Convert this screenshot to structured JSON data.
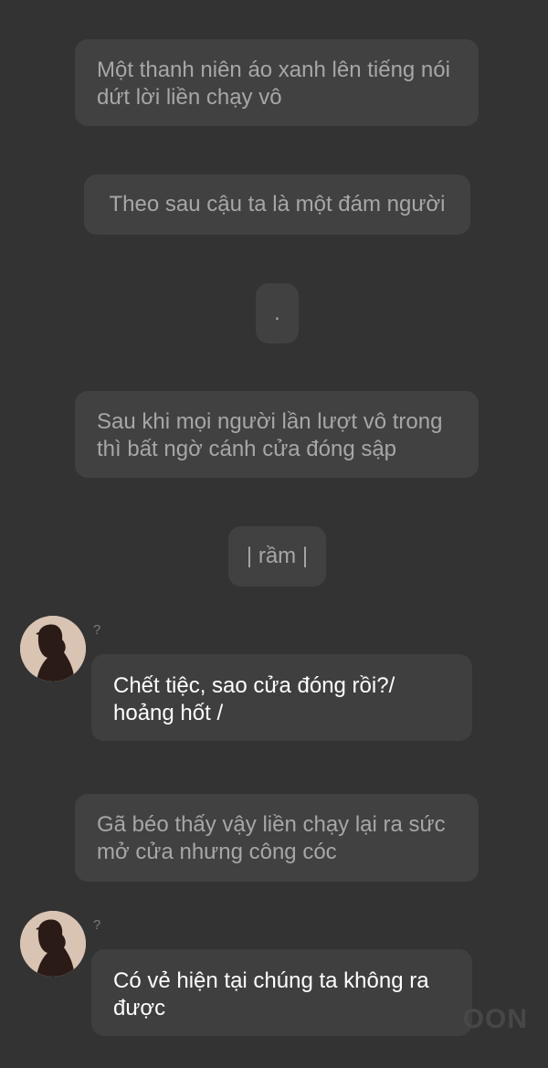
{
  "messages": [
    {
      "type": "narration",
      "text": "Một thanh niên áo xanh lên tiếng nói dứt lời liền chạy vô"
    },
    {
      "type": "narration",
      "text": "Theo sau cậu ta là một đám người"
    },
    {
      "type": "narration",
      "text": "."
    },
    {
      "type": "narration",
      "text": "Sau khi mọi người lần lượt vô trong thì bất ngờ cánh cửa đóng sập"
    },
    {
      "type": "narration",
      "text": "| rầm |"
    },
    {
      "type": "dialog",
      "speaker": "?",
      "text": "Chết tiệc, sao cửa đóng rồi?/ hoảng hốt /"
    },
    {
      "type": "narration",
      "text": "Gã béo thấy vậy liền chạy lại ra sức mở cửa nhưng công cóc"
    },
    {
      "type": "dialog",
      "speaker": "?",
      "text": "Có vẻ hiện tại chúng ta không ra được"
    }
  ],
  "icons": {
    "avatar": "silhouette-avatar-icon"
  },
  "watermark": "OON",
  "colors": {
    "background": "#333333",
    "bubble": "#414141",
    "narration_text": "#a7a7a7",
    "dialog_text": "#ffffff",
    "avatar_bg": "#d9c3b2"
  }
}
